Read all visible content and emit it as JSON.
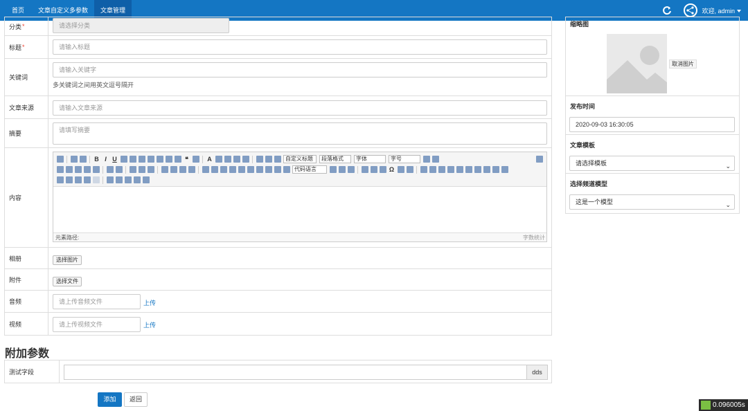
{
  "nav": {
    "items": [
      {
        "label": "首页"
      },
      {
        "label": "文章自定义多参数"
      },
      {
        "label": "文章管理"
      }
    ],
    "user_label": "欢迎, admin"
  },
  "form": {
    "category": {
      "label": "分类",
      "placeholder": "请选择分类"
    },
    "title": {
      "label": "标题",
      "placeholder": "请输入标题"
    },
    "keywords": {
      "label": "关键词",
      "placeholder": "请输入关键字",
      "hint": "多关键词之间用英文逗号隔开"
    },
    "source": {
      "label": "文章来源",
      "placeholder": "请输入文章来源"
    },
    "summary": {
      "label": "摘要",
      "placeholder": "请填写摘要"
    },
    "content": {
      "label": "内容",
      "toolbar": {
        "custom_title": "自定义标题",
        "paragraph": "段落格式",
        "font": "字体",
        "font_size": "字号",
        "code_lang": "代码语言"
      },
      "status_left": "元素路径:",
      "status_right": "字数统计"
    },
    "album": {
      "label": "相册",
      "button": "选择图片"
    },
    "attachment": {
      "label": "附件",
      "button": "选择文件"
    },
    "audio": {
      "label": "音频",
      "placeholder": "请上传音频文件",
      "upload": "上传"
    },
    "video": {
      "label": "视频",
      "placeholder": "请上传视频文件",
      "upload": "上传"
    }
  },
  "extra": {
    "heading": "附加参数",
    "field_label": "测试字段",
    "addon": "dds"
  },
  "actions": {
    "add": "添加",
    "back": "返回"
  },
  "side": {
    "thumbnail": {
      "title": "缩略图",
      "cancel": "取消图片"
    },
    "publish_time": {
      "title": "发布时间",
      "value": "2020-09-03 16:30:05"
    },
    "template": {
      "title": "文章模板",
      "value": "请选择模板"
    },
    "channel_model": {
      "title": "选择频道模型",
      "value": "这是一个模型"
    }
  },
  "perf": {
    "value": "0.096005s"
  },
  "colors": {
    "primary": "#1476c3",
    "required": "#e43"
  }
}
